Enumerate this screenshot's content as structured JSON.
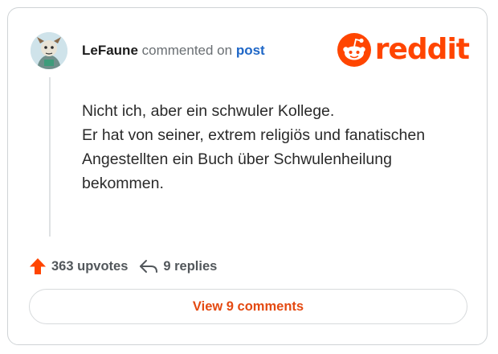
{
  "comment": {
    "author": "LeFaune",
    "action": "commented on",
    "target": "post",
    "lines": [
      "Nicht ich, aber ein schwuler Kollege.",
      "Er hat von seiner, extrem religiös und fanatischen",
      "Angestellten ein Buch über Schwulenheilung",
      "bekommen."
    ]
  },
  "brand": {
    "logo_text": "reddit",
    "icon": "reddit-snoo-icon",
    "color": "#ff4500"
  },
  "stats": {
    "upvotes": "363 upvotes",
    "upvote_icon": "upvote-arrow-icon",
    "upvote_color": "#ff4500",
    "replies": "9 replies",
    "reply_icon": "reply-arrow-icon"
  },
  "button": {
    "label": "View 9 comments"
  }
}
